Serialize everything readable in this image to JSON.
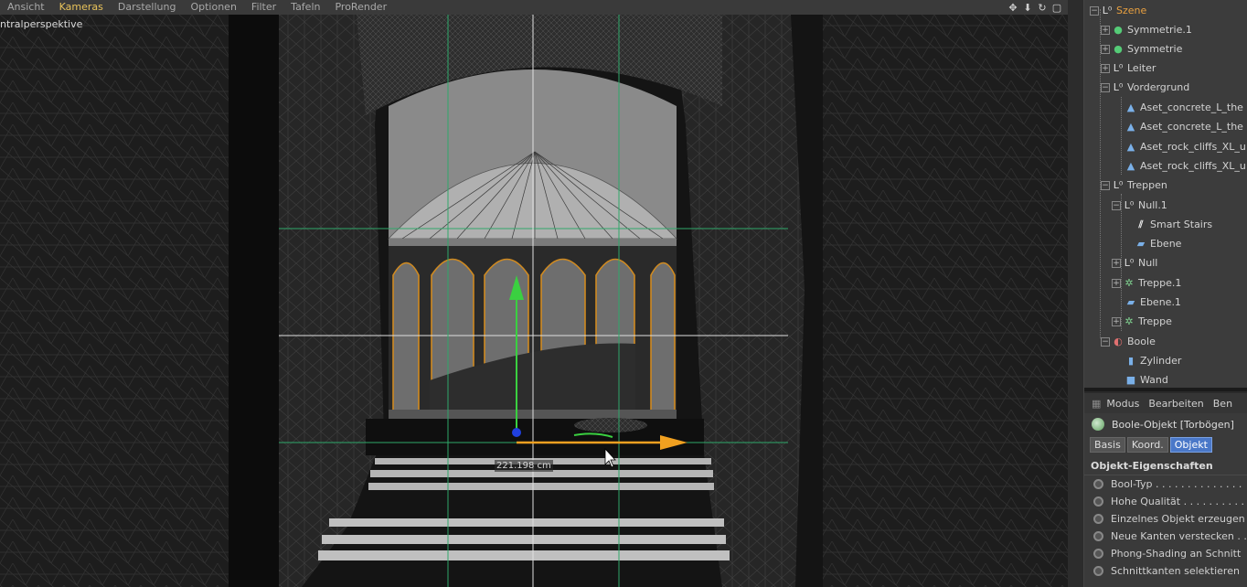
{
  "menubar": {
    "items": [
      {
        "label": "Ansicht",
        "active": false
      },
      {
        "label": "Kameras",
        "active": true
      },
      {
        "label": "Darstellung",
        "active": false
      },
      {
        "label": "Optionen",
        "active": false
      },
      {
        "label": "Filter",
        "active": false
      },
      {
        "label": "Tafeln",
        "active": false
      },
      {
        "label": "ProRender",
        "active": false
      }
    ],
    "nav_icons": [
      "move-view-icon",
      "zoom-view-icon",
      "rotate-view-icon",
      "maximize-view-icon"
    ]
  },
  "viewport": {
    "view_label": "ntralperspektive",
    "measure_label": "221.198 cm",
    "axis_colors": {
      "x": "#f0a020",
      "y": "#3ad040",
      "z": "#2040e0"
    }
  },
  "object_manager": {
    "items": [
      {
        "label": "Szene",
        "icon": "null-icon",
        "selected": true
      },
      {
        "label": "Symmetrie.1",
        "icon": "symmetry-icon"
      },
      {
        "label": "Symmetrie",
        "icon": "symmetry-icon"
      },
      {
        "label": "Leiter",
        "icon": "null-icon"
      },
      {
        "label": "Vordergrund",
        "icon": "null-icon"
      },
      {
        "label": "Aset_concrete_L_the",
        "icon": "polygon-object-icon"
      },
      {
        "label": "Aset_concrete_L_the",
        "icon": "polygon-object-icon"
      },
      {
        "label": "Aset_rock_cliffs_XL_u",
        "icon": "polygon-object-icon"
      },
      {
        "label": "Aset_rock_cliffs_XL_u",
        "icon": "polygon-object-icon"
      },
      {
        "label": "Treppen",
        "icon": "null-icon"
      },
      {
        "label": "Null.1",
        "icon": "null-icon"
      },
      {
        "label": "Smart Stairs",
        "icon": "stairs-icon"
      },
      {
        "label": "Ebene",
        "icon": "plane-icon"
      },
      {
        "label": "Null",
        "icon": "null-icon"
      },
      {
        "label": "Treppe.1",
        "icon": "stair-generator-icon"
      },
      {
        "label": "Ebene.1",
        "icon": "plane-icon"
      },
      {
        "label": "Treppe",
        "icon": "stair-generator-icon"
      },
      {
        "label": "Boole",
        "icon": "boole-icon"
      },
      {
        "label": "Zylinder",
        "icon": "cylinder-icon"
      },
      {
        "label": "Wand",
        "icon": "cube-icon"
      }
    ]
  },
  "attribute_manager": {
    "menu": [
      "Modus",
      "Bearbeiten",
      "Ben"
    ],
    "object_title": "Boole-Objekt [Torbögen]",
    "tabs": [
      {
        "label": "Basis",
        "active": false
      },
      {
        "label": "Koord.",
        "active": false
      },
      {
        "label": "Objekt",
        "active": true
      }
    ],
    "section_title": "Objekt-Eigenschaften",
    "properties": [
      "Bool-Typ . . . . . . . . . . . . . .",
      "Hohe Qualität . . . . . . . . . .",
      "Einzelnes Objekt erzeugen",
      "Neue Kanten verstecken . .",
      "Phong-Shading an Schnitt",
      "Schnittkanten selektieren"
    ]
  }
}
